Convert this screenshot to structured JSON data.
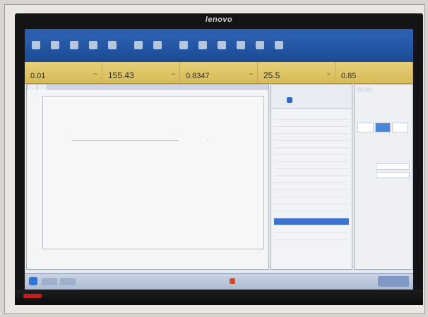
{
  "monitor": {
    "brand": "lenovo"
  },
  "readouts": [
    {
      "value": "0.01"
    },
    {
      "value": "155.43"
    },
    {
      "value": "0.8347"
    },
    {
      "value": "25.5"
    },
    {
      "value": "0.85"
    }
  ],
  "separator": "~",
  "colors": {
    "ribbon": "#1b4a92",
    "readout_strip": "#d8bb56",
    "selection": "#3b73cf",
    "warning": "#d34a2b"
  }
}
